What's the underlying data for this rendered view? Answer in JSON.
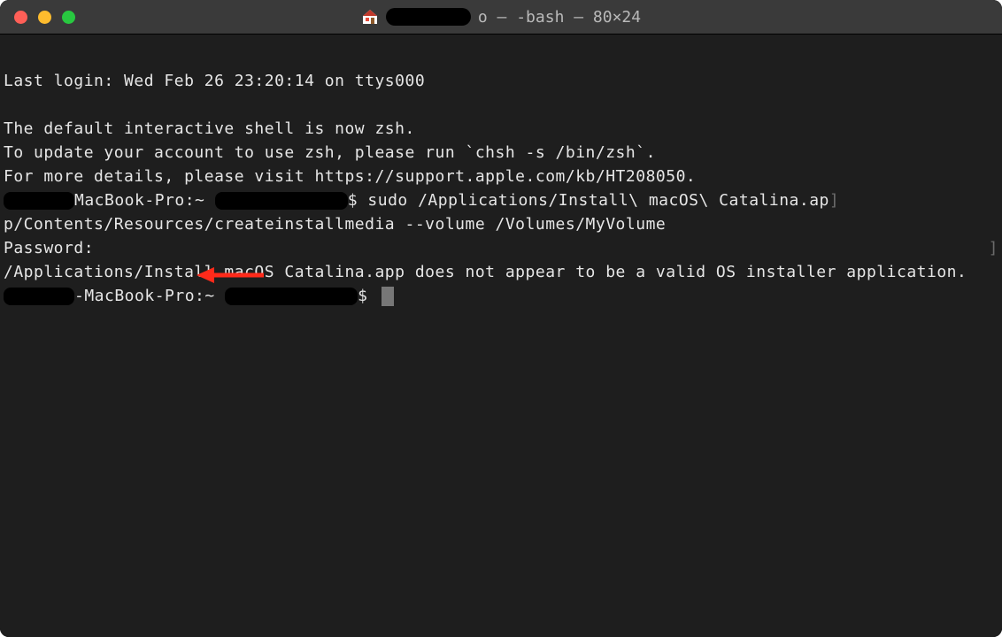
{
  "title": {
    "suffix": "o — -bash — 80×24"
  },
  "terminal": {
    "last_login": "Last login: Wed Feb 26 23:20:14 on ttys000",
    "zsh_line1": "The default interactive shell is now zsh.",
    "zsh_line2": "To update your account to use zsh, please run `chsh -s /bin/zsh`.",
    "zsh_line3": "For more details, please visit https://support.apple.com/kb/HT208050.",
    "prompt1_host": "MacBook-Pro:~ ",
    "prompt1_cmd": "$ sudo /Applications/Install\\ macOS\\ Catalina.ap",
    "cmd_cont": "p/Contents/Resources/createinstallmedia --volume /Volumes/MyVolume",
    "password": "Password:",
    "error": "/Applications/Install macOS Catalina.app does not appear to be a valid OS installer application.",
    "prompt2_host": "-MacBook-Pro:~ ",
    "prompt2_end": "$ "
  }
}
